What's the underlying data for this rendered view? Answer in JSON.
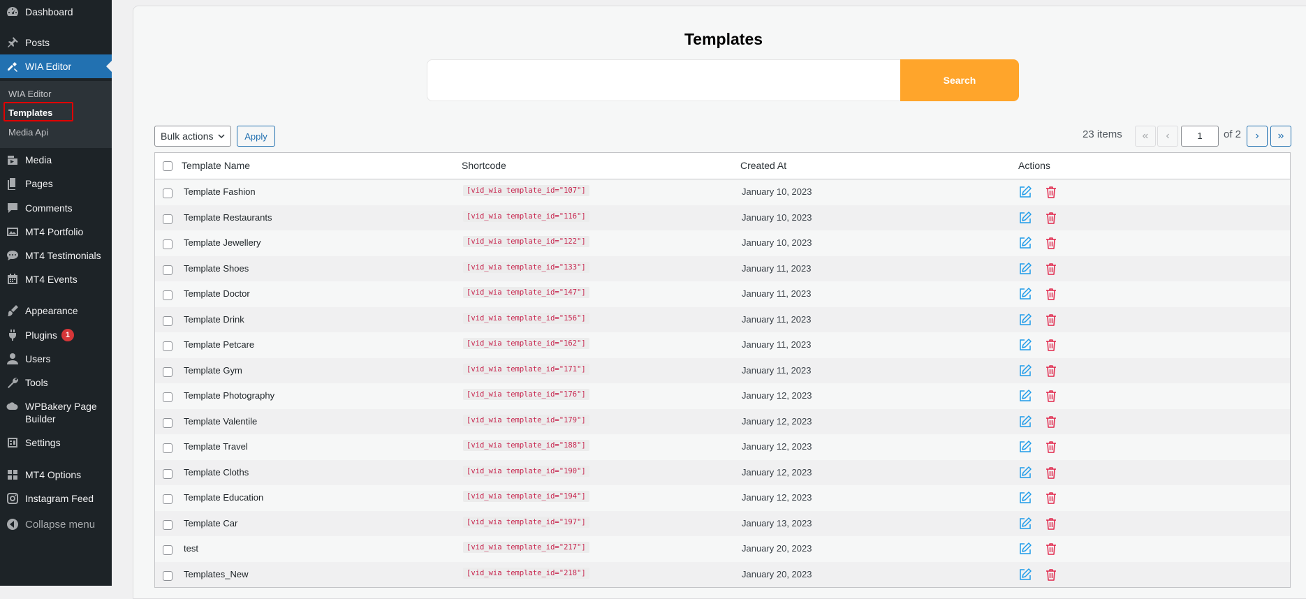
{
  "sidebar": {
    "items": [
      {
        "label": "Dashboard",
        "icon": "dashboard-icon"
      },
      {
        "label": "Posts",
        "icon": "pin-icon"
      },
      {
        "label": "WIA Editor",
        "icon": "editor-icon"
      },
      {
        "label": "Media",
        "icon": "media-icon"
      },
      {
        "label": "Pages",
        "icon": "pages-icon"
      },
      {
        "label": "Comments",
        "icon": "comment-icon"
      },
      {
        "label": "MT4 Portfolio",
        "icon": "portfolio-icon"
      },
      {
        "label": "MT4 Testimonials",
        "icon": "testimonial-icon"
      },
      {
        "label": "MT4 Events",
        "icon": "calendar-icon"
      },
      {
        "label": "Appearance",
        "icon": "brush-icon"
      },
      {
        "label": "Plugins",
        "icon": "plugin-icon",
        "badge": "1"
      },
      {
        "label": "Users",
        "icon": "user-icon"
      },
      {
        "label": "Tools",
        "icon": "wrench-icon"
      },
      {
        "label": "WPBakery Page Builder",
        "icon": "wpbakery-icon"
      },
      {
        "label": "Settings",
        "icon": "settings-icon"
      },
      {
        "label": "MT4 Options",
        "icon": "grid-icon"
      },
      {
        "label": "Instagram Feed",
        "icon": "instagram-icon"
      },
      {
        "label": "Collapse menu",
        "icon": "collapse-icon"
      }
    ],
    "submenu": [
      {
        "label": "WIA Editor"
      },
      {
        "label": "Templates"
      },
      {
        "label": "Media Api"
      }
    ]
  },
  "main": {
    "title": "Templates",
    "search": {
      "value": "",
      "button_label": "Search"
    },
    "bulk_actions": {
      "selected": "Bulk actions",
      "apply_label": "Apply"
    },
    "pagination": {
      "items_count": "23 items",
      "first": "«",
      "prev": "‹",
      "current_page": "1",
      "of_pages": "of 2",
      "next": "›",
      "last": "»"
    },
    "table": {
      "headers": [
        "Template Name",
        "Shortcode",
        "Created At",
        "Actions"
      ],
      "rows": [
        {
          "name": "Template Fashion",
          "shortcode": "[vid_wia template_id=\"107\"]",
          "created": "January 10, 2023"
        },
        {
          "name": "Template Restaurants",
          "shortcode": "[vid_wia template_id=\"116\"]",
          "created": "January 10, 2023"
        },
        {
          "name": "Template Jewellery",
          "shortcode": "[vid_wia template_id=\"122\"]",
          "created": "January 10, 2023"
        },
        {
          "name": "Template Shoes",
          "shortcode": "[vid_wia template_id=\"133\"]",
          "created": "January 11, 2023"
        },
        {
          "name": "Template Doctor",
          "shortcode": "[vid_wia template_id=\"147\"]",
          "created": "January 11, 2023"
        },
        {
          "name": "Template Drink",
          "shortcode": "[vid_wia template_id=\"156\"]",
          "created": "January 11, 2023"
        },
        {
          "name": "Template Petcare",
          "shortcode": "[vid_wia template_id=\"162\"]",
          "created": "January 11, 2023"
        },
        {
          "name": "Template Gym",
          "shortcode": "[vid_wia template_id=\"171\"]",
          "created": "January 11, 2023"
        },
        {
          "name": "Template Photography",
          "shortcode": "[vid_wia template_id=\"176\"]",
          "created": "January 12, 2023"
        },
        {
          "name": "Template Valentile",
          "shortcode": "[vid_wia template_id=\"179\"]",
          "created": "January 12, 2023"
        },
        {
          "name": "Template Travel",
          "shortcode": "[vid_wia template_id=\"188\"]",
          "created": "January 12, 2023"
        },
        {
          "name": "Template Cloths",
          "shortcode": "[vid_wia template_id=\"190\"]",
          "created": "January 12, 2023"
        },
        {
          "name": "Template Education",
          "shortcode": "[vid_wia template_id=\"194\"]",
          "created": "January 12, 2023"
        },
        {
          "name": "Template Car",
          "shortcode": "[vid_wia template_id=\"197\"]",
          "created": "January 13, 2023"
        },
        {
          "name": "test",
          "shortcode": "[vid_wia template_id=\"217\"]",
          "created": "January 20, 2023"
        },
        {
          "name": "Templates_New",
          "shortcode": "[vid_wia template_id=\"218\"]",
          "created": "January 20, 2023"
        }
      ]
    }
  },
  "colors": {
    "sidebar_bg": "#1d2327",
    "active": "#2271b1",
    "search_button": "#ffa52b",
    "edit_icon": "#1e9be9",
    "delete_icon": "#e0264a"
  }
}
